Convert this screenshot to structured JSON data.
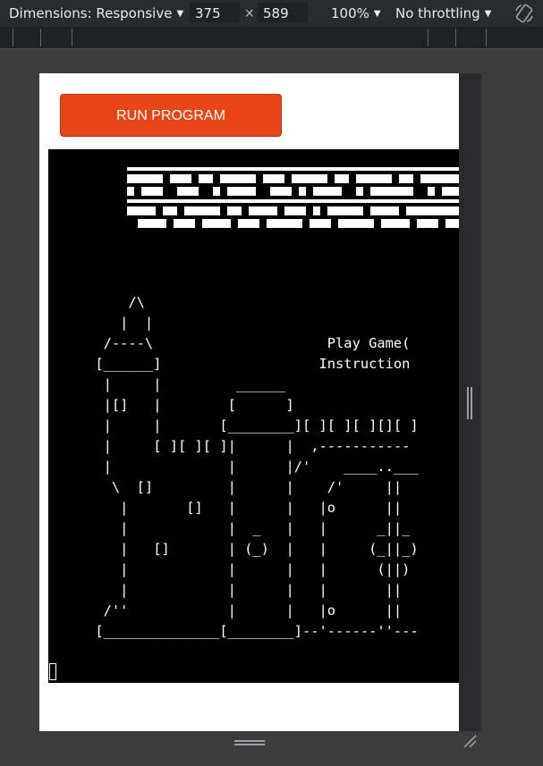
{
  "toolbar": {
    "dimensions_label": "Dimensions: Responsive",
    "width_value": "375",
    "times": "×",
    "height_value": "589",
    "zoom_label": "100%",
    "throttle_label": "No throttling",
    "caret": "▼",
    "rotate_icon": "rotate-icon"
  },
  "page": {
    "run_button_label": "RUN PROGRAM"
  },
  "terminal": {
    "banner_icon": "ascii-title-banner",
    "art": "         /\\\n        |  |\n      /----\\                     Play Game(\n     [______]                   Instruction\n      |     |         ______\n      |[]   |        [      ]\n      |     |       [________][ ][ ][ ][][ ]\n      |     [ ][ ][ ]|      |  ,-----------\n      |              |      |/'    ____..___\n       \\  []         |      |    /'     ||\n        |       []   |      |   |o      ||\n        |            |  _   |   |      _||_\n        |   []       | (_)  |   |     (_||_)\n        |            |      |   |      (||)\n        |            |      |   |       ||\n      /''            |      |   |o      ||\n     [______________[________]--'------''---"
  },
  "colors": {
    "accent": "#e84616",
    "devtools_bg": "#292a2d",
    "terminal_bg": "#000000"
  }
}
